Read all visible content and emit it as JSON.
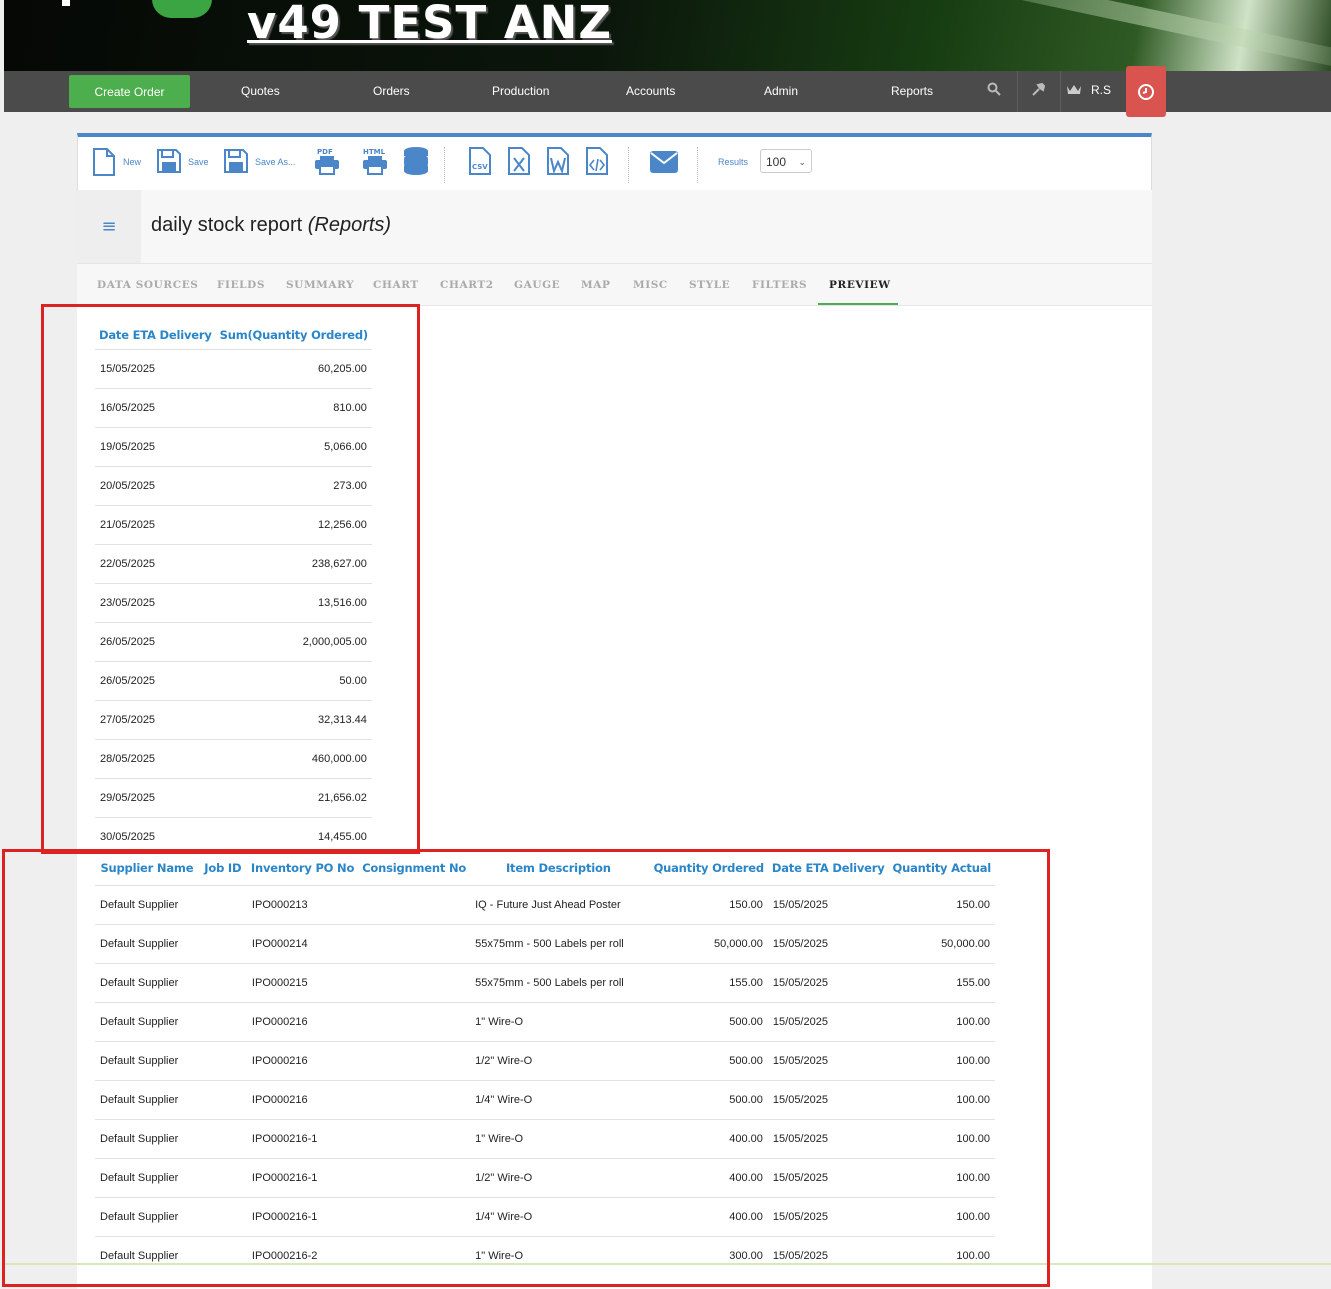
{
  "app": {
    "title": "v49 TEST ANZ"
  },
  "nav": {
    "create_order": "Create Order",
    "items": [
      "Quotes",
      "Orders",
      "Production",
      "Accounts",
      "Admin",
      "Reports"
    ],
    "user": "R.S",
    "icons": [
      "search-icon",
      "wrench-icon",
      "crown-icon",
      "clock-icon"
    ]
  },
  "toolbar": {
    "new": "New",
    "save": "Save",
    "save_as": "Save As...",
    "pdf": "PDF",
    "html": "HTML",
    "csv": "CSV",
    "results_label": "Results",
    "results_value": "100"
  },
  "report": {
    "title": "daily stock report",
    "section": "(Reports)"
  },
  "tabs": [
    "DATA SOURCES",
    "FIELDS",
    "SUMMARY",
    "CHART",
    "CHART2",
    "GAUGE",
    "MAP",
    "MISC",
    "STYLE",
    "FILTERS",
    "PREVIEW"
  ],
  "summary_table": {
    "headers": [
      "Date ETA Delivery",
      "Sum(Quantity Ordered)"
    ],
    "rows": [
      [
        "15/05/2025",
        "60,205.00"
      ],
      [
        "16/05/2025",
        "810.00"
      ],
      [
        "19/05/2025",
        "5,066.00"
      ],
      [
        "20/05/2025",
        "273.00"
      ],
      [
        "21/05/2025",
        "12,256.00"
      ],
      [
        "22/05/2025",
        "238,627.00"
      ],
      [
        "23/05/2025",
        "13,516.00"
      ],
      [
        "26/05/2025",
        "2,000,005.00"
      ],
      [
        "26/05/2025",
        "50.00"
      ],
      [
        "27/05/2025",
        "32,313.44"
      ],
      [
        "28/05/2025",
        "460,000.00"
      ],
      [
        "29/05/2025",
        "21,656.02"
      ],
      [
        "30/05/2025",
        "14,455.00"
      ]
    ]
  },
  "detail_table": {
    "headers": [
      "Supplier Name",
      "Job ID",
      "Inventory PO No",
      "Consignment No",
      "Item Description",
      "Quantity Ordered",
      "Date ETA Delivery",
      "Quantity Actual"
    ],
    "rows": [
      [
        "Default Supplier",
        "",
        "IPO000213",
        "",
        "IQ - Future Just Ahead Poster",
        "150.00",
        "15/05/2025",
        "150.00"
      ],
      [
        "Default Supplier",
        "",
        "IPO000214",
        "",
        "55x75mm - 500 Labels per roll",
        "50,000.00",
        "15/05/2025",
        "50,000.00"
      ],
      [
        "Default Supplier",
        "",
        "IPO000215",
        "",
        "55x75mm - 500 Labels per roll",
        "155.00",
        "15/05/2025",
        "155.00"
      ],
      [
        "Default Supplier",
        "",
        "IPO000216",
        "",
        "1\" Wire-O",
        "500.00",
        "15/05/2025",
        "100.00"
      ],
      [
        "Default Supplier",
        "",
        "IPO000216",
        "",
        "1/2\" Wire-O",
        "500.00",
        "15/05/2025",
        "100.00"
      ],
      [
        "Default Supplier",
        "",
        "IPO000216",
        "",
        "1/4\" Wire-O",
        "500.00",
        "15/05/2025",
        "100.00"
      ],
      [
        "Default Supplier",
        "",
        "IPO000216-1",
        "",
        "1\" Wire-O",
        "400.00",
        "15/05/2025",
        "100.00"
      ],
      [
        "Default Supplier",
        "",
        "IPO000216-1",
        "",
        "1/2\" Wire-O",
        "400.00",
        "15/05/2025",
        "100.00"
      ],
      [
        "Default Supplier",
        "",
        "IPO000216-1",
        "",
        "1/4\" Wire-O",
        "400.00",
        "15/05/2025",
        "100.00"
      ],
      [
        "Default Supplier",
        "",
        "IPO000216-2",
        "",
        "1\" Wire-O",
        "300.00",
        "15/05/2025",
        "100.00"
      ]
    ]
  },
  "colors": {
    "accent_blue": "#2a86c8",
    "green": "#4cae4c",
    "nav_bg": "#4b4b4b",
    "alert_red": "#d9534f",
    "highlight_red": "#dd2222"
  }
}
